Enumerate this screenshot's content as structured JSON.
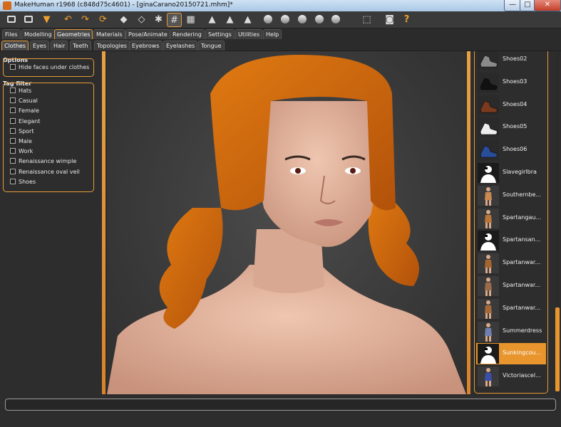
{
  "window": {
    "title": "MakeHuman r1968 (c848d75c4601) - [ginaCarano20150721.mhm]*",
    "minimize": "—",
    "maximize": "□",
    "close": "✕"
  },
  "toolbar": {
    "buttons": [
      {
        "name": "new-file-icon"
      },
      {
        "name": "save-icon"
      },
      {
        "name": "export-icon"
      },
      {
        "name": "undo-icon"
      },
      {
        "name": "redo-icon"
      },
      {
        "name": "reset-icon"
      },
      {
        "name": "smooth-icon"
      },
      {
        "name": "wireframe-icon"
      },
      {
        "name": "pose-icon"
      },
      {
        "name": "grid-icon",
        "active": true
      },
      {
        "name": "checker-icon"
      },
      {
        "name": "front-view-icon"
      },
      {
        "name": "back-view-icon"
      },
      {
        "name": "side-view-icon"
      },
      {
        "name": "head-front-icon"
      },
      {
        "name": "head-round-icon"
      },
      {
        "name": "head-left-icon"
      },
      {
        "name": "head-right-icon"
      },
      {
        "name": "head-top-icon"
      },
      {
        "name": "frame-icon"
      },
      {
        "name": "camera-icon"
      },
      {
        "name": "help-icon"
      }
    ],
    "help_label": "?"
  },
  "main_tabs": [
    "Files",
    "Modelling",
    "Geometries",
    "Materials",
    "Pose/Animate",
    "Rendering",
    "Settings",
    "Utilities",
    "Help"
  ],
  "active_main_tab": "Geometries",
  "sub_tabs": [
    "Clothes",
    "Eyes",
    "Hair",
    "Teeth",
    "Topologies",
    "Eyebrows",
    "Eyelashes",
    "Tongue"
  ],
  "active_sub_tab": "Clothes",
  "options": {
    "title": "Options",
    "items": [
      {
        "label": "Hide faces under clothes",
        "checked": false
      }
    ]
  },
  "tag_filter": {
    "title": "Tag filter",
    "items": [
      {
        "label": "Hats"
      },
      {
        "label": "Casual"
      },
      {
        "label": "Female"
      },
      {
        "label": "Elegant"
      },
      {
        "label": "Sport"
      },
      {
        "label": "Male"
      },
      {
        "label": "Work"
      },
      {
        "label": "Renaissance wimple"
      },
      {
        "label": "Renaissance oval veil"
      },
      {
        "label": "Shoes"
      }
    ]
  },
  "clothes_list": [
    {
      "label": "Shoes02",
      "thumb": "shoe",
      "color": "#8a8a8a"
    },
    {
      "label": "Shoes03",
      "thumb": "shoe",
      "color": "#111111"
    },
    {
      "label": "Shoes04",
      "thumb": "shoe",
      "color": "#7a3a1e"
    },
    {
      "label": "Shoes05",
      "thumb": "shoe",
      "color": "#eeeeee"
    },
    {
      "label": "Shoes06",
      "thumb": "shoe",
      "color": "#2a4d9a"
    },
    {
      "label": "Slavegirlbra",
      "thumb": "silhouette",
      "color": "#ffffff"
    },
    {
      "label": "Southernbe...",
      "thumb": "figure",
      "color": "#c98a52"
    },
    {
      "label": "Spartangau...",
      "thumb": "figure",
      "color": "#b8763a"
    },
    {
      "label": "Spartansan...",
      "thumb": "silhouette",
      "color": "#ffffff"
    },
    {
      "label": "Spartanwar...",
      "thumb": "figure",
      "color": "#a5652f"
    },
    {
      "label": "Spartanwar...",
      "thumb": "figure",
      "color": "#9a6a4a"
    },
    {
      "label": "Spartanwar...",
      "thumb": "figure",
      "color": "#a66a3a"
    },
    {
      "label": "Summerdress",
      "thumb": "figure",
      "color": "#6e7fb0"
    },
    {
      "label": "Sunkingcou...",
      "thumb": "silhouette",
      "color": "#ffffff",
      "selected": true
    },
    {
      "label": "Victoriascel...",
      "thumb": "figure",
      "color": "#3a4fa8"
    }
  ],
  "statusbar": {
    "text": ""
  }
}
